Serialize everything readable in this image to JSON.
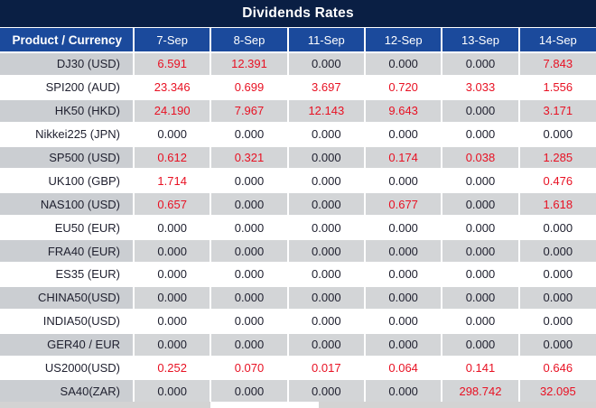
{
  "title": "Dividends Rates",
  "table": {
    "product_header": "Product / Currency",
    "date_columns": [
      "7-Sep",
      "8-Sep",
      "11-Sep",
      "12-Sep",
      "13-Sep",
      "14-Sep"
    ],
    "rows": [
      {
        "product": "DJ30 (USD)",
        "values": [
          "6.591",
          "12.391",
          "0.000",
          "0.000",
          "0.000",
          "7.843"
        ]
      },
      {
        "product": "SPI200 (AUD)",
        "values": [
          "23.346",
          "0.699",
          "3.697",
          "0.720",
          "3.033",
          "1.556"
        ]
      },
      {
        "product": "HK50 (HKD)",
        "values": [
          "24.190",
          "7.967",
          "12.143",
          "9.643",
          "0.000",
          "3.171"
        ]
      },
      {
        "product": "Nikkei225 (JPN)",
        "values": [
          "0.000",
          "0.000",
          "0.000",
          "0.000",
          "0.000",
          "0.000"
        ]
      },
      {
        "product": "SP500 (USD)",
        "values": [
          "0.612",
          "0.321",
          "0.000",
          "0.174",
          "0.038",
          "1.285"
        ]
      },
      {
        "product": "UK100 (GBP)",
        "values": [
          "1.714",
          "0.000",
          "0.000",
          "0.000",
          "0.000",
          "0.476"
        ]
      },
      {
        "product": "NAS100 (USD)",
        "values": [
          "0.657",
          "0.000",
          "0.000",
          "0.677",
          "0.000",
          "1.618"
        ]
      },
      {
        "product": "EU50 (EUR)",
        "values": [
          "0.000",
          "0.000",
          "0.000",
          "0.000",
          "0.000",
          "0.000"
        ]
      },
      {
        "product": "FRA40 (EUR)",
        "values": [
          "0.000",
          "0.000",
          "0.000",
          "0.000",
          "0.000",
          "0.000"
        ]
      },
      {
        "product": "ES35 (EUR)",
        "values": [
          "0.000",
          "0.000",
          "0.000",
          "0.000",
          "0.000",
          "0.000"
        ]
      },
      {
        "product": "CHINA50(USD)",
        "values": [
          "0.000",
          "0.000",
          "0.000",
          "0.000",
          "0.000",
          "0.000"
        ]
      },
      {
        "product": "INDIA50(USD)",
        "values": [
          "0.000",
          "0.000",
          "0.000",
          "0.000",
          "0.000",
          "0.000"
        ]
      },
      {
        "product": "GER40 / EUR",
        "values": [
          "0.000",
          "0.000",
          "0.000",
          "0.000",
          "0.000",
          "0.000"
        ]
      },
      {
        "product": "US2000(USD)",
        "values": [
          "0.252",
          "0.070",
          "0.017",
          "0.064",
          "0.141",
          "0.646"
        ]
      },
      {
        "product": "SA40(ZAR)",
        "values": [
          "0.000",
          "0.000",
          "0.000",
          "0.000",
          "298.742",
          "32.095"
        ]
      }
    ]
  },
  "colors": {
    "title_bar_bg": "#0a1f44",
    "header_bg": "#1b4a9c",
    "row_bg": "#ffffff",
    "row_alt_bg": "#d3d5d7",
    "row_alt_product_bg": "#cbced2",
    "value_nonzero": "#e81123",
    "value_zero": "#202130",
    "divider": "#ffffff",
    "footer_strip_bg": "#d3d3d3"
  }
}
